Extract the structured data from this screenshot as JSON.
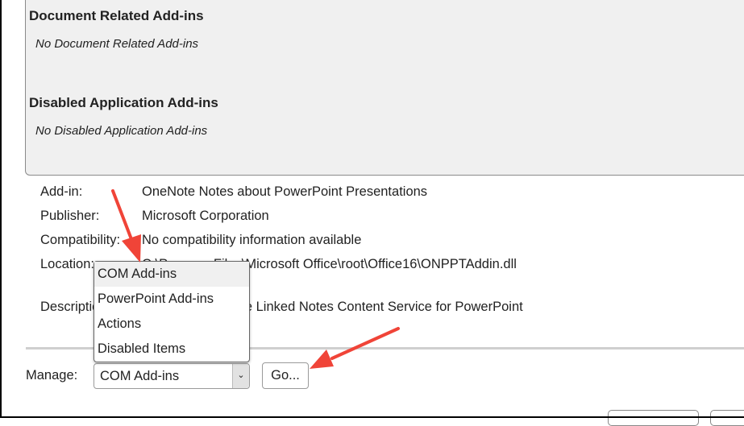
{
  "sections": [
    {
      "title": "Document Related Add-ins",
      "empty_text": "No Document Related Add-ins"
    },
    {
      "title": "Disabled Application Add-ins",
      "empty_text": "No Disabled Application Add-ins"
    }
  ],
  "details": {
    "addin_label": "Add-in:",
    "addin_value": "OneNote Notes about PowerPoint Presentations",
    "publisher_label": "Publisher:",
    "publisher_value": "Microsoft Corporation",
    "compat_label": "Compatibility:",
    "compat_value": "No compatibility information available",
    "location_label": "Location:",
    "location_value": "C:\\Program Files\\Microsoft Office\\root\\Office16\\ONPPTAddin.dll",
    "description_label": "Description:",
    "description_value": "OneNote Linked Notes Content Service for PowerPoint"
  },
  "manage": {
    "label": "Manage:",
    "selected": "COM Add-ins",
    "go_label": "Go...",
    "options": [
      "COM Add-ins",
      "PowerPoint Add-ins",
      "Actions",
      "Disabled Items"
    ]
  },
  "colors": {
    "arrow": "#f04438",
    "panel": "#f0f0f0"
  }
}
